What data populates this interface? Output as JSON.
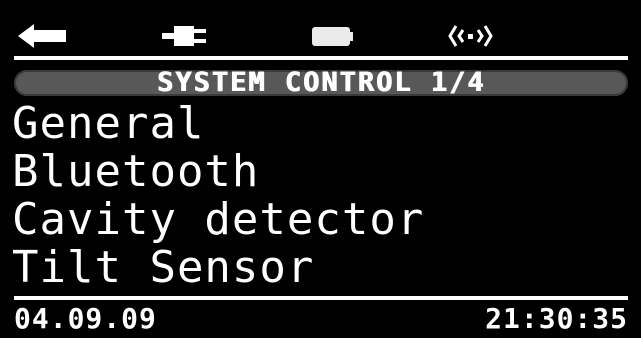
{
  "status_bar": {
    "icons": [
      "back-arrow-icon",
      "plug-icon",
      "battery-icon",
      "wireless-signal-icon"
    ]
  },
  "title": "SYSTEM CONTROL 1/4",
  "menu": {
    "items": [
      {
        "label": "General"
      },
      {
        "label": "Bluetooth"
      },
      {
        "label": "Cavity detector"
      },
      {
        "label": "Tilt Sensor"
      }
    ]
  },
  "footer": {
    "date": "04.09.09",
    "time": "21:30:35"
  },
  "colors": {
    "background": "#000000",
    "foreground": "#ffffff",
    "title_bar": "#585858"
  }
}
